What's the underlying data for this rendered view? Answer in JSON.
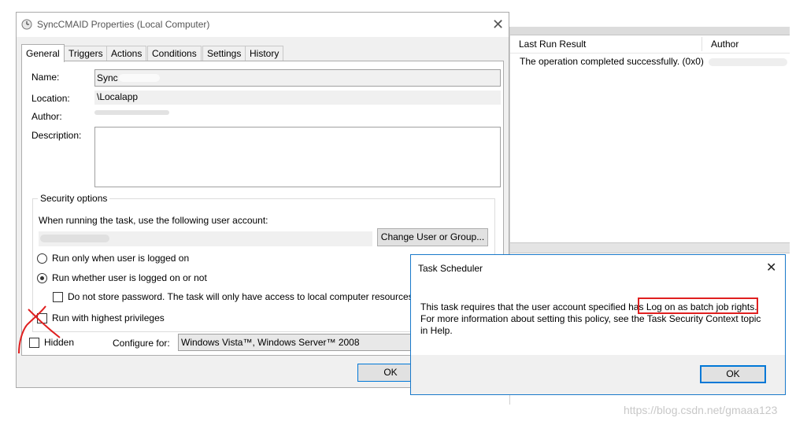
{
  "background_window": {
    "columns": [
      "Last Run Result",
      "Author"
    ],
    "row_result": "The operation completed successfully. (0x0)"
  },
  "properties_dialog": {
    "title": "SyncCMAID Properties (Local Computer)",
    "tabs": [
      "General",
      "Triggers",
      "Actions",
      "Conditions",
      "Settings",
      "History"
    ],
    "active_tab": "General",
    "name_label": "Name:",
    "name_value": "Sync",
    "location_label": "Location:",
    "location_value": "\\Localapp",
    "author_label": "Author:",
    "description_label": "Description:",
    "security_title": "Security options",
    "user_account_prompt": "When running the task, use the following user account:",
    "change_user_button": "Change User or Group...",
    "radio_logged_on": "Run only when user is logged on",
    "radio_whether": "Run whether user is logged on or not",
    "radio_selected": "whether",
    "do_not_store_password": "Do not store password.  The task will only have access to local computer resources.",
    "do_not_store_checked": false,
    "highest_privileges": "Run with highest privileges",
    "highest_privileges_checked": false,
    "hidden_label": "Hidden",
    "hidden_checked": false,
    "configure_for_label": "Configure for:",
    "configure_for_value": "Windows Vista™, Windows Server™ 2008",
    "ok_button": "OK"
  },
  "message_box": {
    "title": "Task Scheduler",
    "text_before": "This task requires that the user account specified has ",
    "text_highlight": "Log on as batch job rights.",
    "text_after": " For more information about setting this policy, see the Task Security Context topic in Help.",
    "ok_button": "OK"
  },
  "annotation_color": "#e02020",
  "watermark": "https://blog.csdn.net/gmaaa123"
}
